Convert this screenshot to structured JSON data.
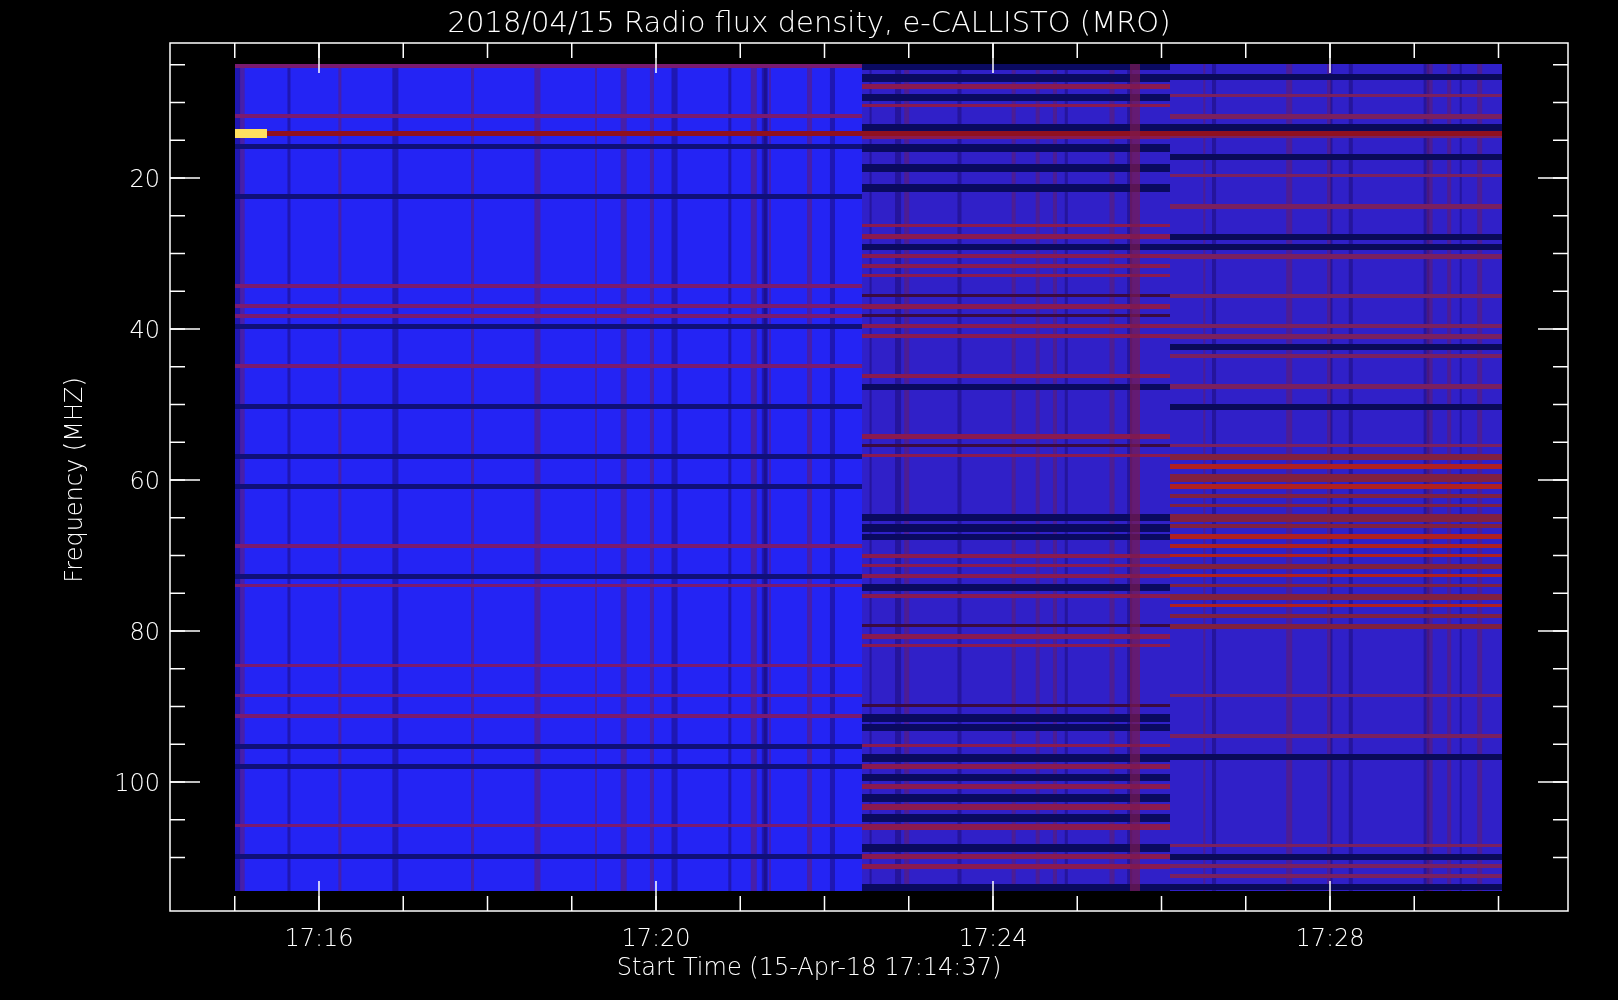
{
  "title": "2018/04/15  Radio flux density, e-CALLISTO (MRO)",
  "y_axis": {
    "label": "Frequency (MHZ)",
    "ticks": [
      "20",
      "40",
      "60",
      "80",
      "100"
    ]
  },
  "x_axis": {
    "label": "Start Time (15-Apr-18 17:14:37)",
    "ticks": [
      "17:16",
      "17:20",
      "17:24",
      "17:28"
    ]
  }
}
